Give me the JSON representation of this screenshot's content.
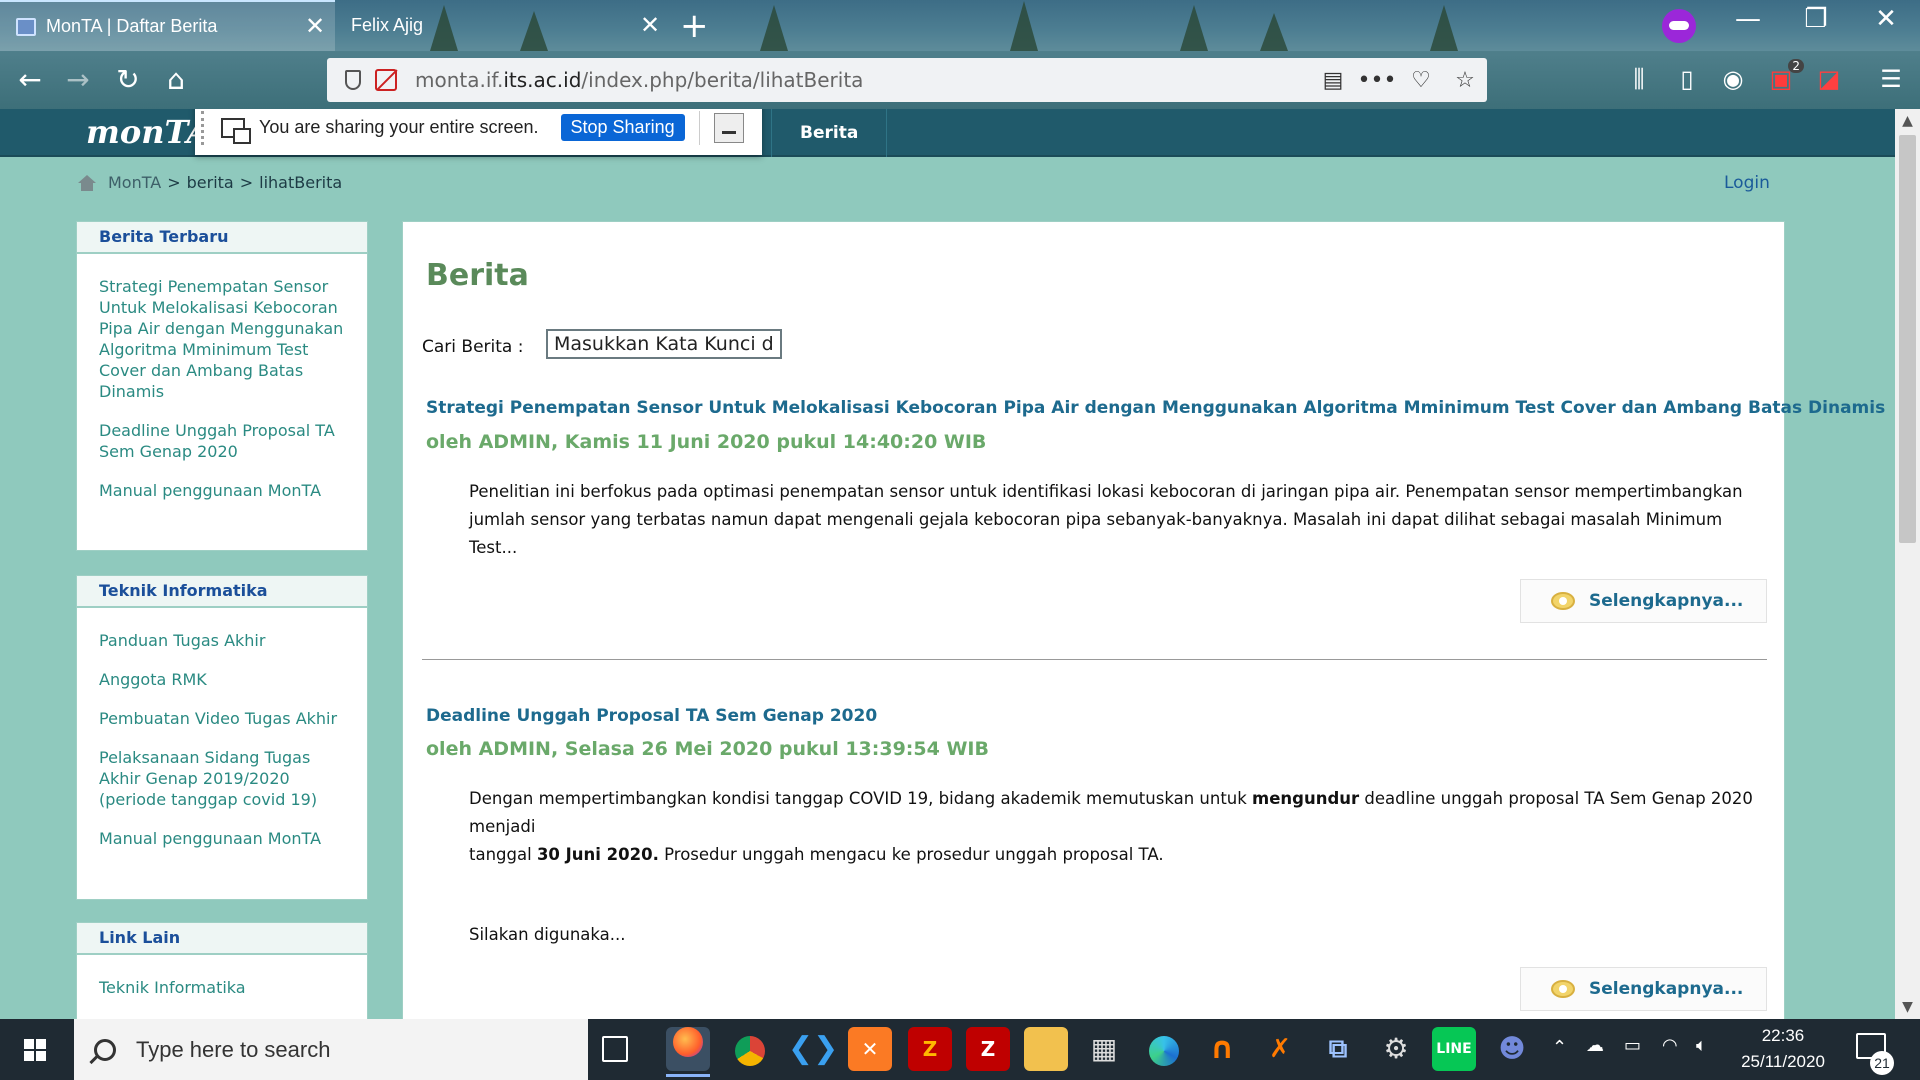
{
  "browser": {
    "tabs": [
      {
        "title": "MonTA | Daftar Berita",
        "close": "✕"
      },
      {
        "title": "Felix Ajig",
        "close": "✕"
      }
    ],
    "new_tab": "+",
    "window_controls": {
      "minimize": "—",
      "restore": "❐",
      "close": "✕"
    },
    "url": {
      "prefix": "monta.if.",
      "domain": "its.ac.id",
      "path": "/index.php/berita/lihatBerita"
    },
    "toolbar_icons": [
      "back-arrow-icon",
      "forward-arrow-icon",
      "reload-icon",
      "home-icon",
      "reader-view-icon",
      "more-actions-icon",
      "pocket-icon",
      "bookmark-star-icon",
      "library-icon",
      "sidebar-icon",
      "account-icon",
      "addon-lock-icon",
      "addon-tool-icon",
      "menu-icon"
    ],
    "addon_badge": "2"
  },
  "share_bar": {
    "text": "You are sharing your entire screen.",
    "stop_label": "Stop Sharing"
  },
  "site": {
    "logo": "monTA",
    "nav": [
      {
        "label": "Berita"
      }
    ],
    "breadcrumb": {
      "home": "MonTA",
      "sep": ">",
      "level1": "berita",
      "level2": "lihatBerita"
    },
    "login": "Login"
  },
  "sidebar": {
    "boxes": [
      {
        "title": "Berita Terbaru",
        "links": [
          "Strategi Penempatan Sensor Untuk Melokalisasi Kebocoran Pipa Air dengan Menggunakan Algoritma Mminimum Test Cover dan Ambang Batas Dinamis",
          "Deadline Unggah Proposal TA Sem Genap 2020",
          "Manual penggunaan MonTA"
        ]
      },
      {
        "title": "Teknik Informatika",
        "links": [
          "Panduan Tugas Akhir",
          "Anggota RMK",
          "Pembuatan Video Tugas Akhir",
          "Pelaksanaan Sidang Tugas Akhir Genap 2019/2020 (periode tanggap covid 19)",
          "Manual penggunaan MonTA"
        ]
      },
      {
        "title": "Link Lain",
        "links": [
          "Teknik Informatika"
        ]
      }
    ]
  },
  "main": {
    "title": "Berita",
    "search": {
      "label": "Cari Berita :",
      "value": "Masukkan Kata Kunci di s"
    },
    "articles": [
      {
        "title": "Strategi Penempatan Sensor Untuk Melokalisasi Kebocoran Pipa Air dengan Menggunakan Algoritma Mminimum Test Cover dan Ambang Batas Dinamis",
        "meta": "oleh ADMIN, Kamis 11 Juni 2020 pukul 14:40:20 WIB",
        "body_line1": "Penelitian ini berfokus pada optimasi penempatan sensor untuk identifikasi lokasi kebocoran di jaringan pipa air. Penempatan sensor mempertimbangkan",
        "body_line2": "jumlah sensor yang terbatas namun dapat mengenali gejala kebocoran pipa sebanyak-banyaknya. Masalah ini dapat dilihat sebagai masalah Minimum Test...",
        "more": "Selengkapnya..."
      },
      {
        "title": "Deadline Unggah Proposal TA Sem Genap 2020",
        "meta": "oleh ADMIN, Selasa 26 Mei 2020 pukul 13:39:54 WIB",
        "body_a": "Dengan mempertimbangkan kondisi tanggap COVID 19, bidang akademik memutuskan untuk ",
        "body_b": "mengundur",
        "body_c": " deadline unggah proposal TA Sem Genap 2020 menjadi",
        "body_d": "tanggal ",
        "body_e": "30 Juni 2020.",
        "body_f": " Prosedur unggah mengacu ke prosedur unggah proposal TA.",
        "body_g": "Silakan digunaka...",
        "more": "Selengkapnya..."
      }
    ]
  },
  "taskbar": {
    "search_placeholder": "Type here to search",
    "time": "22:36",
    "date": "25/11/2020",
    "notifications": "21"
  }
}
